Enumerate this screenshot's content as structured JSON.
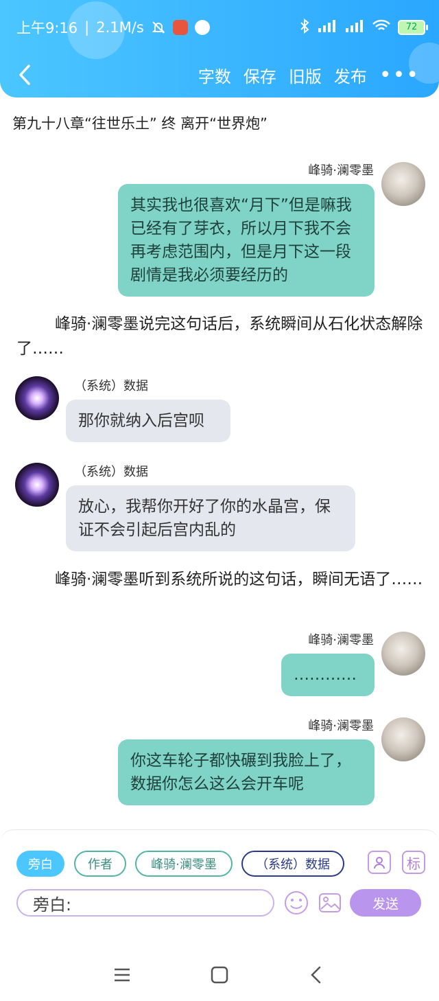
{
  "status_bar": {
    "time": "上午9:16",
    "separator": "|",
    "network_speed": "2.1M/s",
    "battery_level": "72"
  },
  "toolbar": {
    "word_count": "字数",
    "save": "保存",
    "old_version": "旧版",
    "publish": "发布",
    "more": "•••"
  },
  "chapter_title": "第九十八章“往世乐土” 终   离开“世界炮”",
  "messages": [
    {
      "type": "right",
      "name": "峰骑·澜零墨",
      "text": "其实我也很喜欢“月下”但是嘛我已经有了芽衣，所以月下我不会再考虑范围内，但是月下这一段剧情是我必须要经历的"
    },
    {
      "type": "narration",
      "text": "峰骑·澜零墨说完这句话后，系统瞬间从石化状态解除了……"
    },
    {
      "type": "left",
      "name": "（系统）数据",
      "text": "那你就纳入后宫呗"
    },
    {
      "type": "left",
      "name": "（系统）数据",
      "text": "放心，我帮你开好了你的水晶宫，保证不会引起后宫内乱的"
    },
    {
      "type": "narration",
      "text": "峰骑·澜零墨听到系统所说的这句话，瞬间无语了……"
    },
    {
      "type": "right",
      "name": "峰骑·澜零墨",
      "text": "…………"
    },
    {
      "type": "right",
      "name": "峰骑·澜零墨",
      "text": "你这车轮子都快碾到我脸上了，数据你怎么这么会开车呢"
    }
  ],
  "compose": {
    "roles": [
      "旁白",
      "作者",
      "峰骑·澜零墨",
      "（系统）数据"
    ],
    "contact_icon_label": "",
    "tag_button": "标",
    "input_value": "旁白:",
    "send": "发送"
  },
  "colors": {
    "header": "#2aa7ff",
    "right_bubble": "#7fd4c7",
    "left_bubble": "#e4e7ee",
    "send": "#b995ee"
  }
}
